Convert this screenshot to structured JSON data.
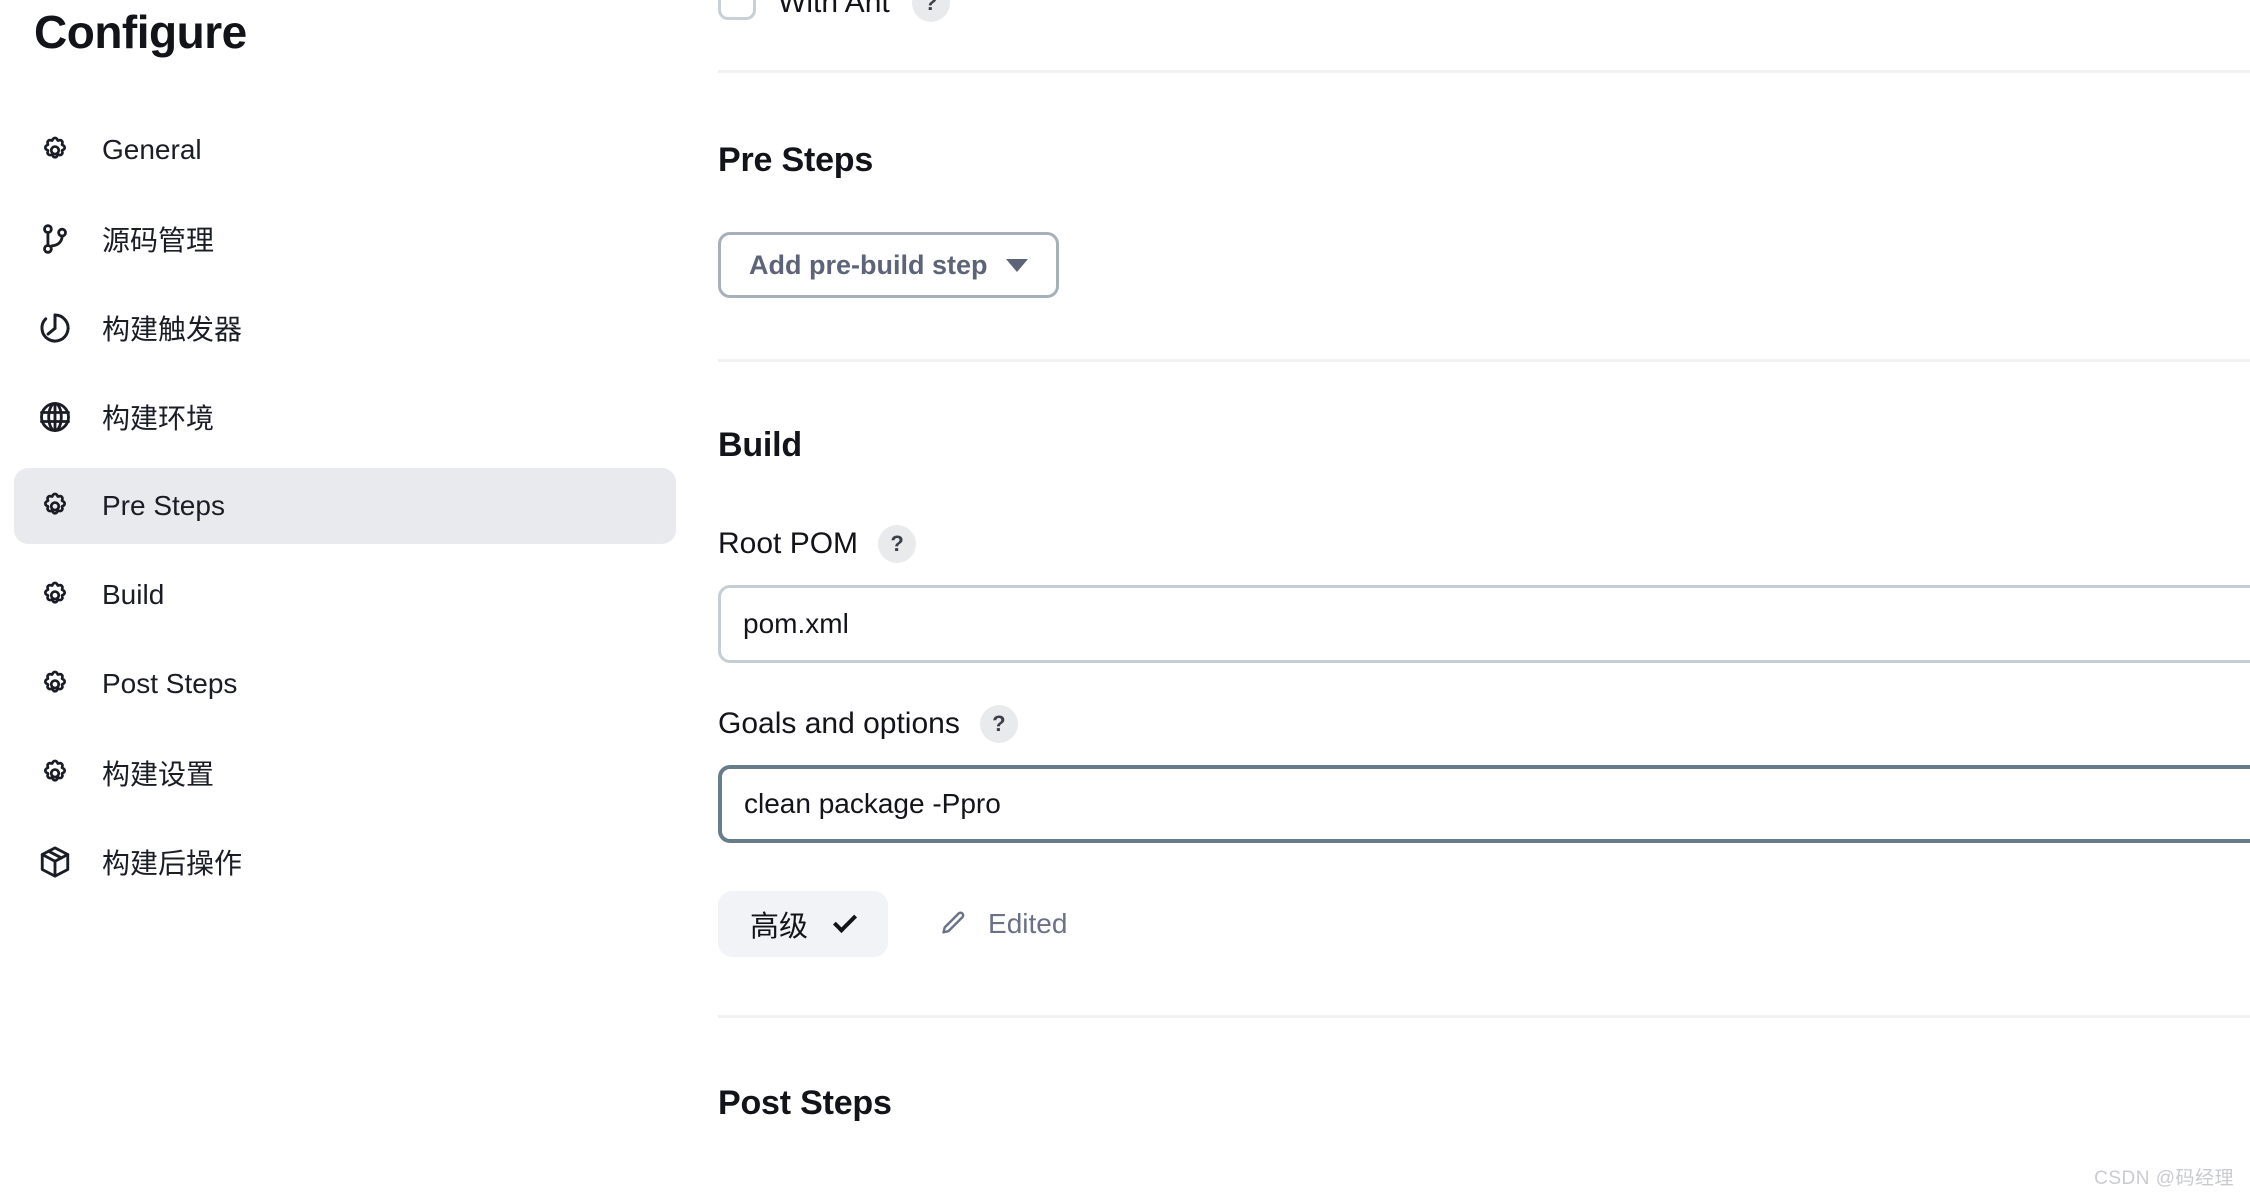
{
  "page": {
    "title": "Configure",
    "watermark": "CSDN @码经理"
  },
  "sidebar": {
    "items": [
      {
        "label": "General",
        "icon": "gear-icon",
        "active": false
      },
      {
        "label": "源码管理",
        "icon": "git-branch-icon",
        "active": false
      },
      {
        "label": "构建触发器",
        "icon": "timer-icon",
        "active": false
      },
      {
        "label": "构建环境",
        "icon": "globe-icon",
        "active": false
      },
      {
        "label": "Pre Steps",
        "icon": "gear-icon",
        "active": true
      },
      {
        "label": "Build",
        "icon": "gear-icon",
        "active": false
      },
      {
        "label": "Post Steps",
        "icon": "gear-icon",
        "active": false
      },
      {
        "label": "构建设置",
        "icon": "gear-icon",
        "active": false
      },
      {
        "label": "构建后操作",
        "icon": "package-icon",
        "active": false
      }
    ]
  },
  "main": {
    "with_ant": {
      "label": "With Ant",
      "help": "?",
      "checked": false
    },
    "pre_steps": {
      "heading": "Pre Steps",
      "add_button_label": "Add pre-build step"
    },
    "build": {
      "heading": "Build",
      "root_pom": {
        "label": "Root POM",
        "help": "?",
        "value": "pom.xml",
        "placeholder": "pom.xml"
      },
      "goals": {
        "label": "Goals and options",
        "help": "?",
        "value": "clean package -Ppro",
        "placeholder": ""
      },
      "advanced_label": "高级",
      "edited_label": "Edited"
    },
    "post_steps": {
      "heading": "Post Steps"
    }
  },
  "colors": {
    "text": "#13141a",
    "muted": "#6b7187",
    "active_bg": "#e8eaed",
    "divider": "#f0f1f3",
    "focus_border": "#687d8c",
    "input_border": "#c4ced4"
  }
}
